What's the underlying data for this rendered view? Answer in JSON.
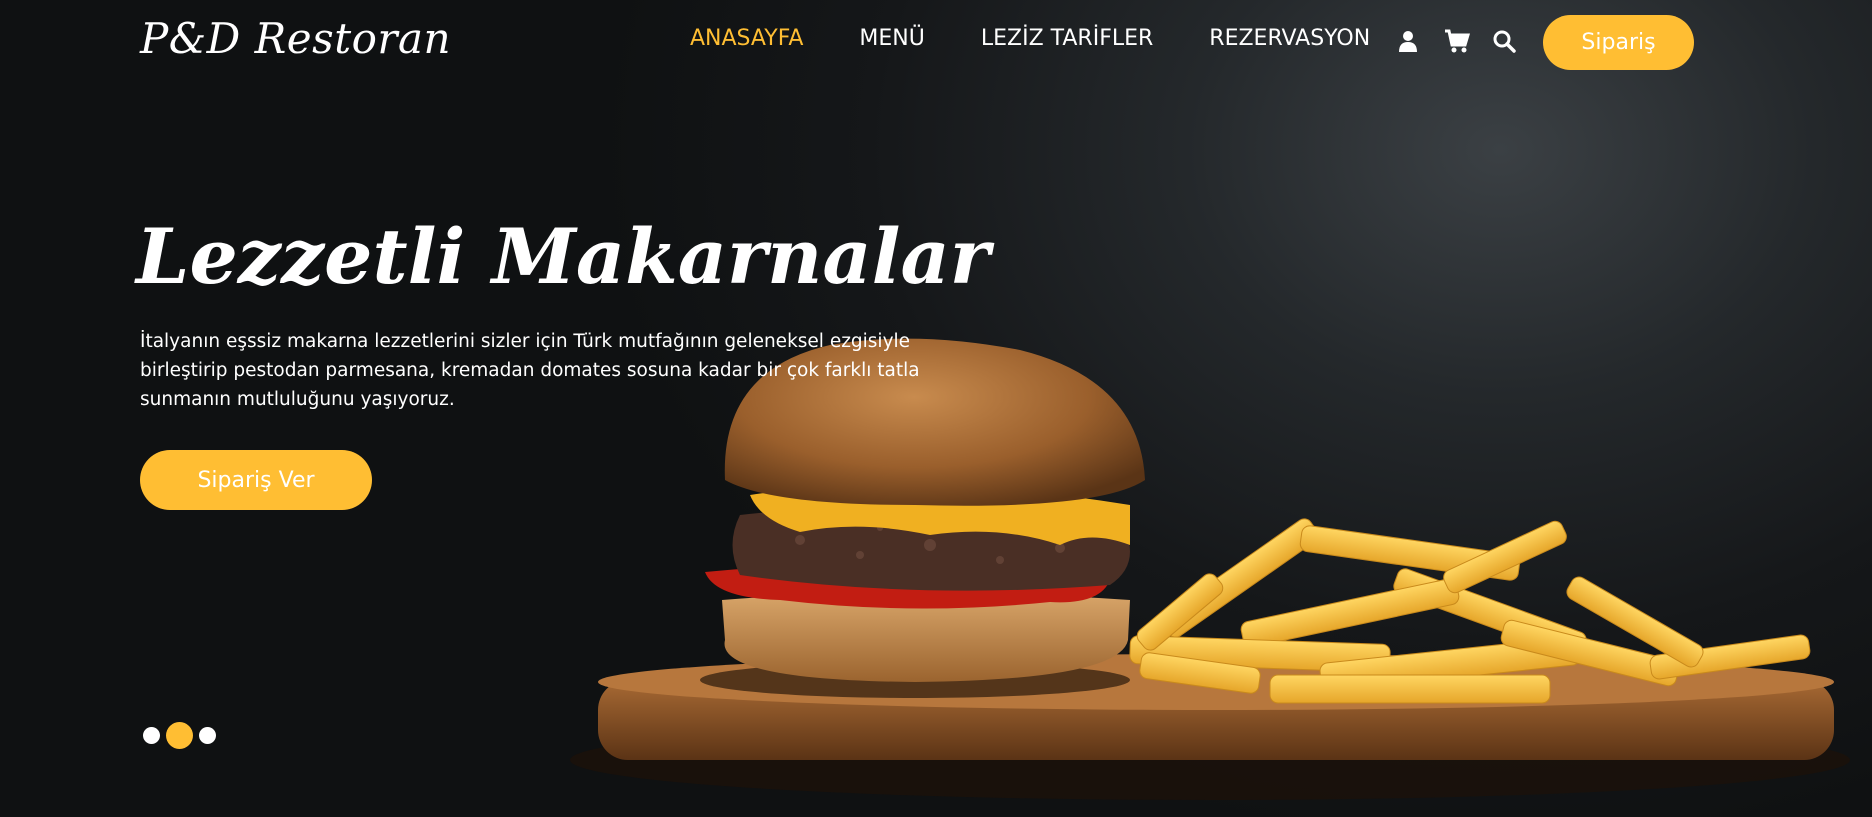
{
  "header": {
    "logo": "P&D Restoran",
    "nav": [
      {
        "label": "ANASAYFA",
        "active": true
      },
      {
        "label": "MENÜ",
        "active": false
      },
      {
        "label": "LEZİZ TARİFLER",
        "active": false
      },
      {
        "label": "REZERVASYON",
        "active": false
      }
    ],
    "icons": [
      "user-icon",
      "cart-icon",
      "search-icon"
    ],
    "order_button": "Sipariş"
  },
  "hero": {
    "title": "Lezzetli Makarnalar",
    "description_lines": [
      "İtalyanın eşssiz makarna lezzetlerini sizler için Türk mutfağının geleneksel ezgisiyle",
      "birleştirip pestodan parmesana, kremadan domates sosuna kadar bir çok farklı tatla",
      "sunmanın mutluluğunu yaşıyoruz."
    ],
    "cta_label": "Sipariş Ver",
    "slides": 3,
    "active_slide": 2
  },
  "colors": {
    "accent": "#ffbe33",
    "background": "#121416",
    "text": "#ffffff"
  }
}
